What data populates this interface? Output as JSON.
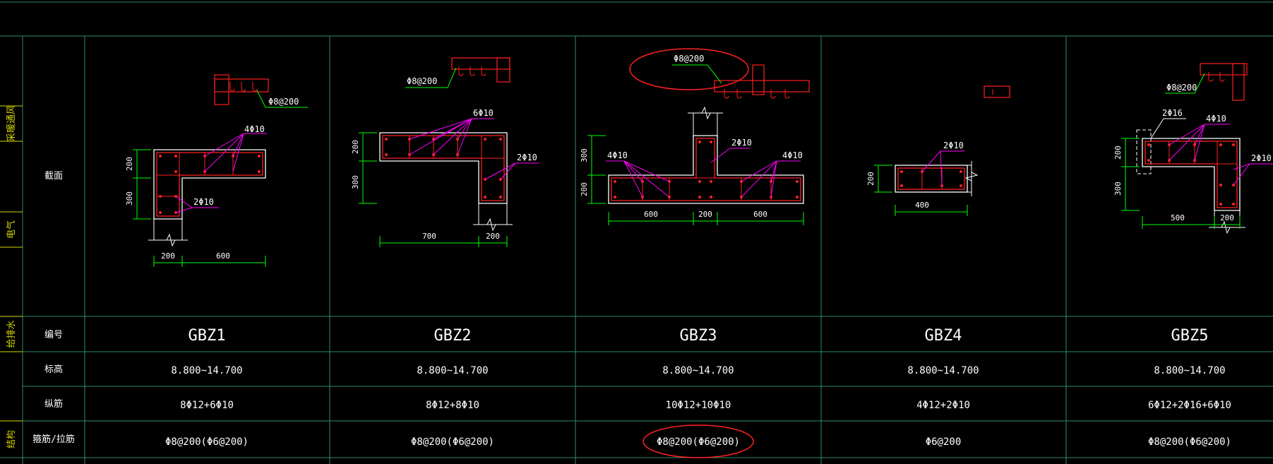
{
  "side_labels": [
    "采暖通风",
    "电气",
    "给排水",
    "结构"
  ],
  "row_labels": {
    "section": "截面",
    "id": "编号",
    "elevation": "标高",
    "longitudinal": "纵筋",
    "stirrup": "箍筋/拉筋"
  },
  "columns": [
    {
      "id": "GBZ1",
      "elevation": "8.800~14.700",
      "longitudinal": "8Φ12+6Φ10",
      "stirrup": "Φ8@200(Φ6@200)"
    },
    {
      "id": "GBZ2",
      "elevation": "8.800~14.700",
      "longitudinal": "8Φ12+8Φ10",
      "stirrup": "Φ8@200(Φ6@200)"
    },
    {
      "id": "GBZ3",
      "elevation": "8.800~14.700",
      "longitudinal": "10Φ12+10Φ10",
      "stirrup": "Φ8@200(Φ6@200)"
    },
    {
      "id": "GBZ4",
      "elevation": "8.800~14.700",
      "longitudinal": "4Φ12+2Φ10",
      "stirrup": "Φ6@200"
    },
    {
      "id": "GBZ5",
      "elevation": "8.800~14.700",
      "longitudinal": "6Φ12+2Φ16+6Φ10",
      "stirrup": "Φ8@200(Φ6@200)"
    }
  ],
  "details": {
    "gbz1": {
      "hook": "Φ8@200",
      "bars_a": "4Φ10",
      "bars_b": "2Φ10",
      "dims": [
        "200",
        "300",
        "200",
        "600"
      ]
    },
    "gbz2": {
      "hook": "Φ8@200",
      "bars_a": "6Φ10",
      "bars_b": "2Φ10",
      "dims": [
        "200",
        "300",
        "700",
        "200"
      ]
    },
    "gbz3": {
      "hook": "Φ8@200",
      "bars_a": "2Φ10",
      "bars_b": "4Φ10",
      "bars_c": "4Φ10",
      "dims": [
        "300",
        "200",
        "600",
        "200",
        "600"
      ]
    },
    "gbz4": {
      "bars_a": "2Φ10",
      "dims": [
        "200",
        "400"
      ]
    },
    "gbz5": {
      "hook": "Φ8@200",
      "bars_a": "2Φ16",
      "bars_b": "4Φ10",
      "bars_c": "2Φ10",
      "dims": [
        "200",
        "300",
        "500",
        "200"
      ]
    }
  },
  "colors": {
    "background": "#000000",
    "grid": "#2e8b6d",
    "text": "#ffffff",
    "section_outline": "#ffffff",
    "rebar": "#ff2020",
    "leader": "#ff00ff",
    "dimension": "#00ff00",
    "hook_leader": "#00ff00",
    "highlight_ellipse": "#ff2020",
    "side_label": "#d6d600"
  }
}
